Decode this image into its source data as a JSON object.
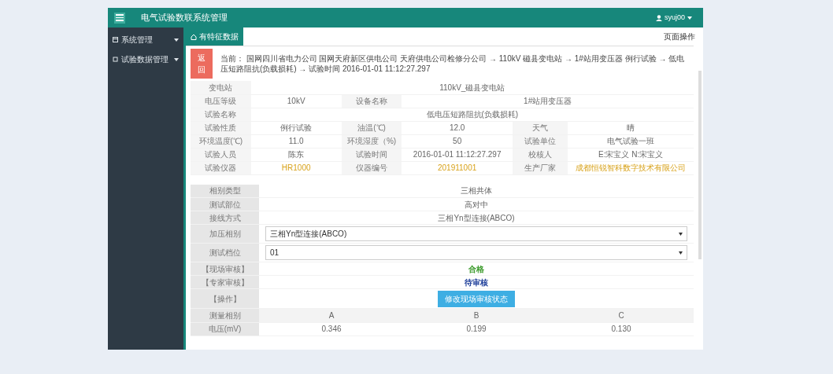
{
  "header": {
    "title": "电气试验数联系统管理",
    "user": "syuj00"
  },
  "sidebar": {
    "items": [
      {
        "label": "系统管理",
        "expanded": false
      },
      {
        "label": "试验数据管理",
        "expanded": false
      }
    ]
  },
  "tabs": [
    {
      "label": "有特征数据",
      "selected": true
    }
  ],
  "page_actions": "页面操作",
  "back_button": "返回",
  "breadcrumb": "当前： 国网四川省电力公司 国网天府新区供电公司 天府供电公司检修分公司 → 110kV 磁县变电站 → 1#站用变压器 例行试验 → 低电压短路阻抗(负载损耗) → 试验时间 2016-01-01 11:12:27.297",
  "info_table": {
    "rows": [
      [
        {
          "kind": "label",
          "text": "变电站"
        },
        {
          "kind": "value",
          "text": "110kV_磁县变电站",
          "colspan": 5
        }
      ],
      [
        {
          "kind": "label",
          "text": "电压等级"
        },
        {
          "kind": "value",
          "text": "10kV"
        },
        {
          "kind": "label",
          "text": "设备名称"
        },
        {
          "kind": "value",
          "text": "1#站用变压器",
          "colspan": 3
        }
      ],
      [
        {
          "kind": "label",
          "text": "试验名称"
        },
        {
          "kind": "value",
          "text": "低电压短路阻抗(负载损耗)",
          "colspan": 5
        }
      ],
      [
        {
          "kind": "label",
          "text": "试验性质"
        },
        {
          "kind": "value",
          "text": "例行试验"
        },
        {
          "kind": "label",
          "text": "油温(℃)"
        },
        {
          "kind": "value",
          "text": "12.0"
        },
        {
          "kind": "label",
          "text": "天气"
        },
        {
          "kind": "value",
          "text": "晴"
        }
      ],
      [
        {
          "kind": "label",
          "text": "环境温度(℃)"
        },
        {
          "kind": "value",
          "text": "11.0"
        },
        {
          "kind": "label",
          "text": "环境湿度（%)"
        },
        {
          "kind": "value",
          "text": "50"
        },
        {
          "kind": "label",
          "text": "试验单位"
        },
        {
          "kind": "value",
          "text": "电气试验一班"
        }
      ],
      [
        {
          "kind": "label",
          "text": "试验人员"
        },
        {
          "kind": "value",
          "text": "陈东"
        },
        {
          "kind": "label",
          "text": "试验时间"
        },
        {
          "kind": "value",
          "text": "2016-01-01 11:12:27.297"
        },
        {
          "kind": "label",
          "text": "校核人"
        },
        {
          "kind": "value",
          "text": "E:宋宝义 N:宋宝义"
        }
      ],
      [
        {
          "kind": "label",
          "text": "试验仪器"
        },
        {
          "kind": "highlight",
          "text": "HR1000"
        },
        {
          "kind": "label",
          "text": "仪器编号"
        },
        {
          "kind": "highlight",
          "text": "201911001"
        },
        {
          "kind": "label",
          "text": "生产厂家"
        },
        {
          "kind": "highlight",
          "text": "成都恒锐智科数字技术有限公司"
        }
      ]
    ]
  },
  "detail_table": {
    "rows": [
      {
        "label": "相别类型",
        "kind": "text",
        "value": "三相共体"
      },
      {
        "label": "测试部位",
        "kind": "text",
        "value": "高对中"
      },
      {
        "label": "接线方式",
        "kind": "text",
        "value": "三相Yn型连接(ABCO)"
      },
      {
        "label": "加压相别",
        "kind": "select",
        "value": "三相Yn型连接(ABCO)"
      },
      {
        "label": "测试档位",
        "kind": "select",
        "value": "01"
      },
      {
        "label": "【现场审核】",
        "kind": "status",
        "value": "合格",
        "color": "#3a9a2a"
      },
      {
        "label": "【专家审核】",
        "kind": "status",
        "value": "待审核",
        "color": "#1f3f9a"
      },
      {
        "label": "【操作】",
        "kind": "button",
        "value": "修改现场审核状态"
      }
    ]
  },
  "measure_table": {
    "columns": [
      "测量相别",
      "A",
      "B",
      "C"
    ],
    "rows": [
      [
        "电压(mV)",
        "0.346",
        "0.199",
        "0.130"
      ]
    ]
  }
}
